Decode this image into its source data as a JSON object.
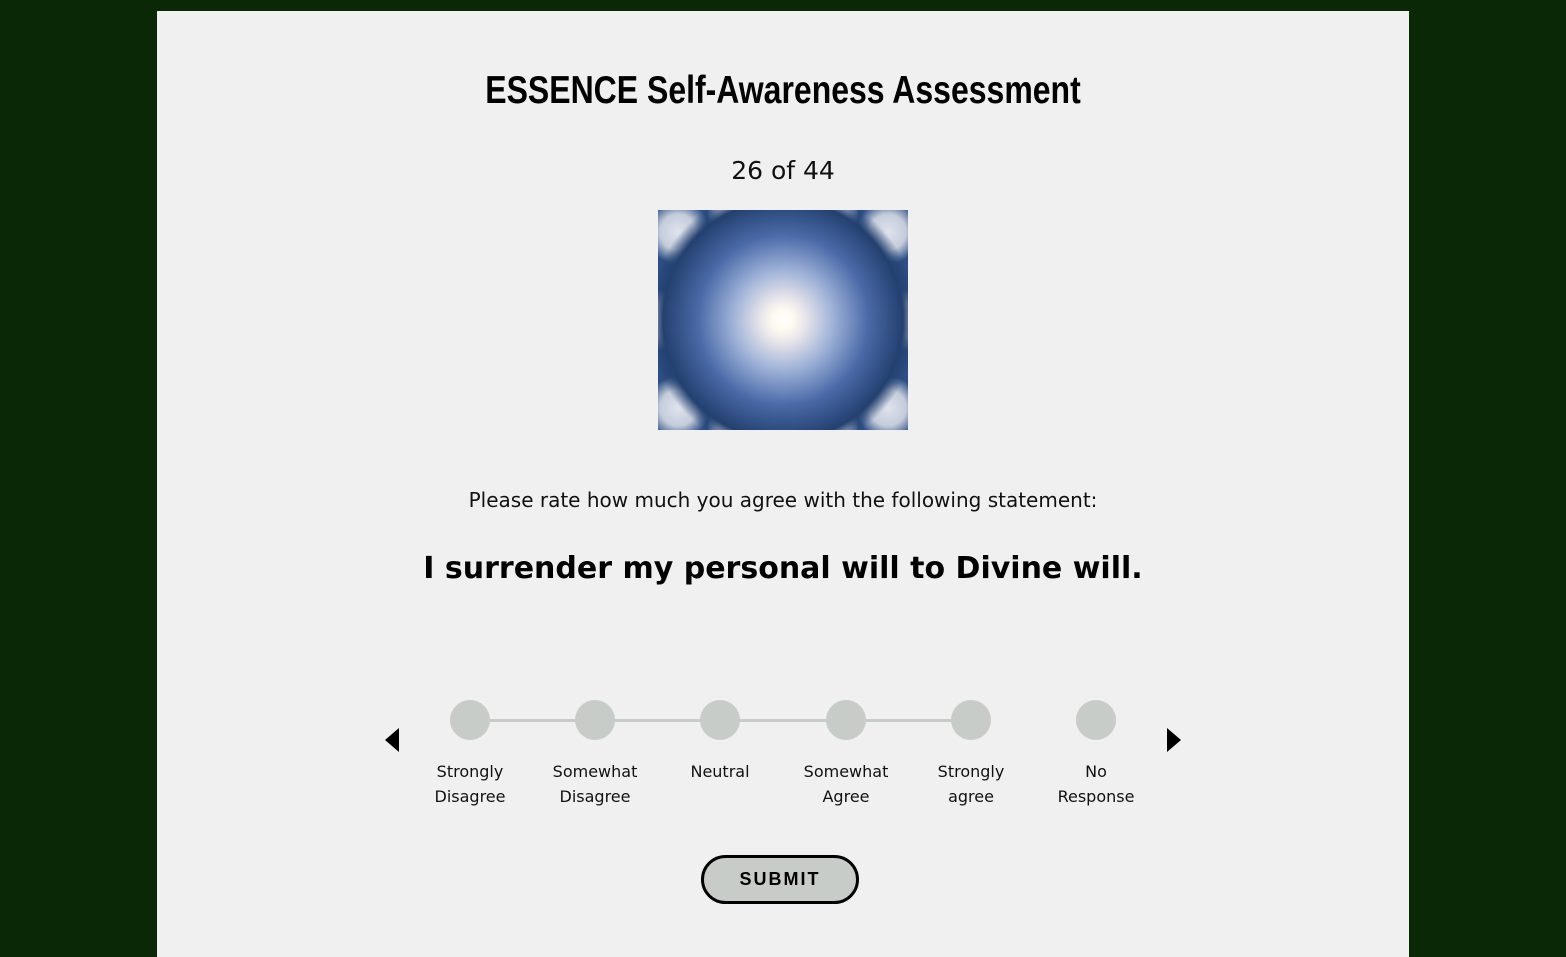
{
  "page": {
    "background_color": "#0b2806",
    "card_color": "#f0f0f0"
  },
  "header": {
    "title": "ESSENCE Self-Awareness Assessment"
  },
  "progress": {
    "text": "26 of 44",
    "current": 26,
    "total": 44
  },
  "question": {
    "image_icon": "cloud-mandala-image",
    "prompt": "Please rate how much you agree with the following statement:",
    "statement": "I surrender my personal will to Divine will."
  },
  "scale": {
    "dot_color": "#c8ccc9",
    "selected": null,
    "options": [
      {
        "label": "Strongly\nDisagree"
      },
      {
        "label": "Somewhat\nDisagree"
      },
      {
        "label": "Neutral"
      },
      {
        "label": "Somewhat\nAgree"
      },
      {
        "label": "Strongly\nagree"
      },
      {
        "label": "No\nResponse"
      }
    ],
    "prev_icon": "triangle-left-icon",
    "next_icon": "triangle-right-icon"
  },
  "actions": {
    "submit_label": "SUBMIT"
  }
}
